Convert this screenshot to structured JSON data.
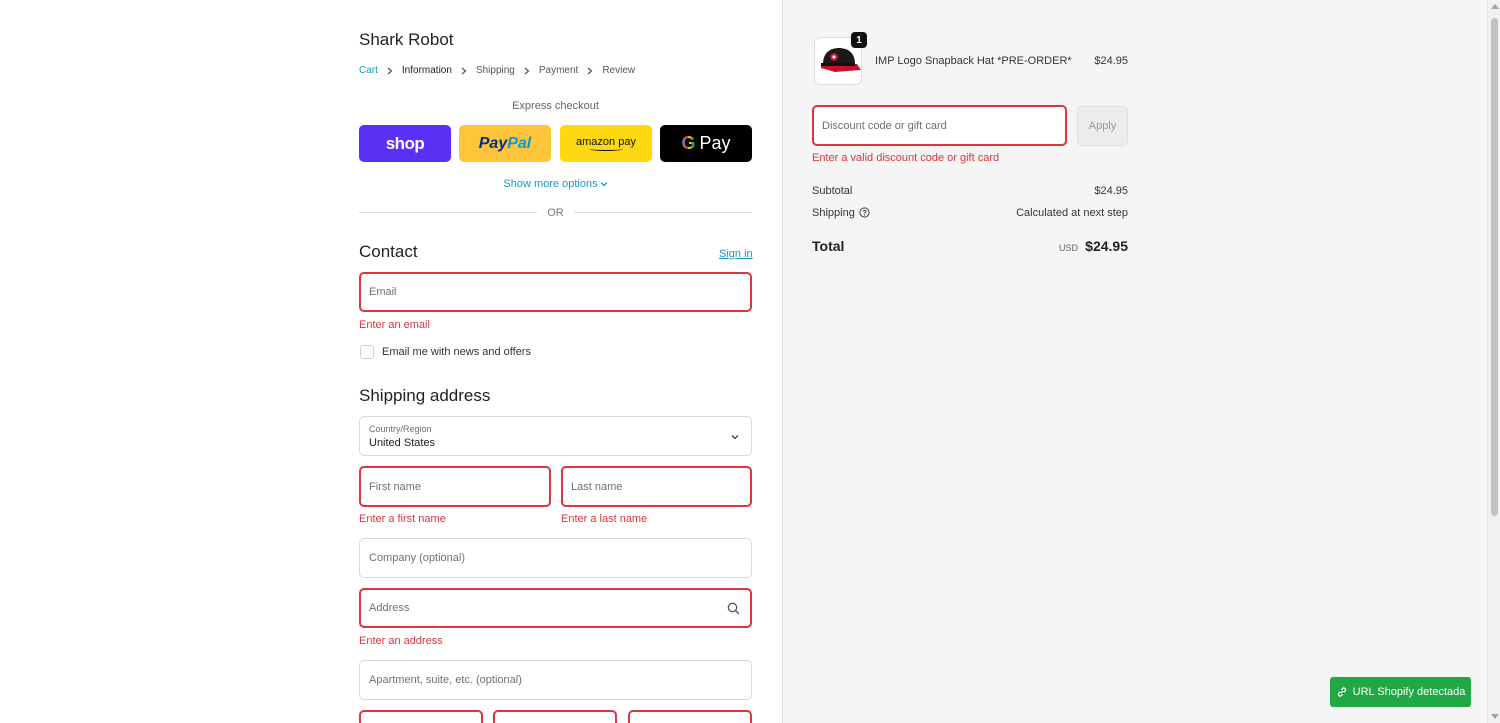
{
  "store": {
    "name": "Shark Robot"
  },
  "breadcrumb": {
    "items": [
      {
        "label": "Cart"
      },
      {
        "label": "Information"
      },
      {
        "label": "Shipping"
      },
      {
        "label": "Payment"
      },
      {
        "label": "Review"
      }
    ]
  },
  "express": {
    "label": "Express checkout",
    "shop": "shop",
    "paypal_a": "Pay",
    "paypal_b": "Pal",
    "amazon": "amazon pay",
    "gpay": "Pay",
    "show_more": "Show more options",
    "or": "OR"
  },
  "contact": {
    "title": "Contact",
    "sign_in": "Sign in",
    "email_placeholder": "Email",
    "email_error": "Enter an email",
    "newsletter_label": "Email me with news and offers"
  },
  "shipping": {
    "title": "Shipping address",
    "country_label": "Country/Region",
    "country_value": "United States",
    "first_name_placeholder": "First name",
    "first_name_error": "Enter a first name",
    "last_name_placeholder": "Last name",
    "last_name_error": "Enter a last name",
    "company_placeholder": "Company (optional)",
    "address_placeholder": "Address",
    "address_error": "Enter an address",
    "apartment_placeholder": "Apartment, suite, etc. (optional)"
  },
  "summary": {
    "product": {
      "name": "IMP Logo Snapback Hat *PRE-ORDER*",
      "price": "$24.95",
      "quantity": "1"
    },
    "discount_placeholder": "Discount code or gift card",
    "apply_label": "Apply",
    "discount_error": "Enter a valid discount code or gift card",
    "subtotal_label": "Subtotal",
    "subtotal_value": "$24.95",
    "shipping_label": "Shipping",
    "shipping_value": "Calculated at next step",
    "total_label": "Total",
    "currency": "USD",
    "total_value": "$24.95"
  },
  "extension_badge": {
    "label": "URL Shopify detectada"
  },
  "colors": {
    "error": "#d9363e",
    "link": "#1a98c4",
    "shop": "#5a31f4",
    "paypal": "#ffc439",
    "amazon": "#ffd814",
    "badge": "#22a745"
  }
}
